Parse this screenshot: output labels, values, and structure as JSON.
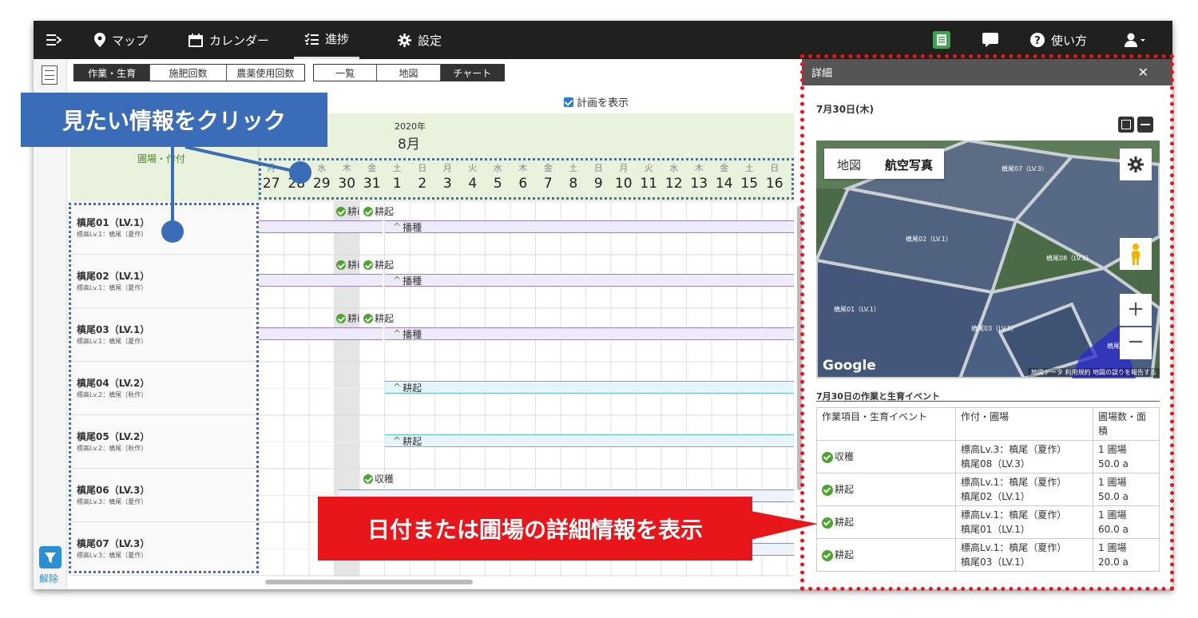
{
  "topbar": {
    "items": [
      {
        "label": "マップ",
        "icon": "map-pin-icon"
      },
      {
        "label": "カレンダー",
        "icon": "calendar-icon"
      },
      {
        "label": "進捗",
        "icon": "checklist-icon",
        "active": true
      },
      {
        "label": "設定",
        "icon": "gear-icon"
      }
    ],
    "help_label": "使い方"
  },
  "tabs_category": [
    "作業・生育",
    "施肥回数",
    "農薬使用回数"
  ],
  "tabs_view": [
    "一覧",
    "地図",
    "チャート"
  ],
  "show_plan_label": "計画を表示",
  "chart": {
    "header_left": "圃場・作付",
    "year": "2020年",
    "month": "8月",
    "days": [
      {
        "w": "月",
        "d": "27"
      },
      {
        "w": "火",
        "d": "28"
      },
      {
        "w": "水",
        "d": "29"
      },
      {
        "w": "木",
        "d": "30"
      },
      {
        "w": "金",
        "d": "31"
      },
      {
        "w": "土",
        "d": "1"
      },
      {
        "w": "日",
        "d": "2"
      },
      {
        "w": "月",
        "d": "3"
      },
      {
        "w": "火",
        "d": "4"
      },
      {
        "w": "水",
        "d": "5"
      },
      {
        "w": "木",
        "d": "6"
      },
      {
        "w": "金",
        "d": "7"
      },
      {
        "w": "土",
        "d": "8"
      },
      {
        "w": "日",
        "d": "9"
      },
      {
        "w": "月",
        "d": "10"
      },
      {
        "w": "火",
        "d": "11"
      },
      {
        "w": "水",
        "d": "12"
      },
      {
        "w": "木",
        "d": "13"
      },
      {
        "w": "金",
        "d": "14"
      },
      {
        "w": "土",
        "d": "15"
      },
      {
        "w": "日",
        "d": "16"
      }
    ],
    "rows": [
      {
        "name": "槙尾01（LV.1）",
        "sub": "標高Lv.1：槙尾（夏作）"
      },
      {
        "name": "槙尾02（LV.1）",
        "sub": "標高Lv.1：槙尾（夏作）"
      },
      {
        "name": "槙尾03（LV.1）",
        "sub": "標高Lv.1：槙尾（夏作）"
      },
      {
        "name": "槙尾04（LV.2）",
        "sub": "標高Lv.2：槙尾（秋作）"
      },
      {
        "name": "槙尾05（LV.2）",
        "sub": "標高Lv.2：槙尾（秋作）"
      },
      {
        "name": "槙尾06（LV.3）",
        "sub": "標高Lv.3：槙尾（夏作）"
      },
      {
        "name": "槙尾07（LV.3）",
        "sub": "標高Lv.3：槙尾（夏作）"
      }
    ],
    "ev_kouki_short": "耕i",
    "ev_kouki": "耕起",
    "ev_hashu": "播種",
    "ev_shukaku": "収穫"
  },
  "filter_release": "解除",
  "detail": {
    "title": "詳細",
    "date": "7月30日(木)",
    "map_tabs": [
      "地図",
      "航空写真"
    ],
    "map_labels": [
      "槙尾07（LV.3）",
      "槙尾02（LV.1）",
      "槙尾08（LV.3）",
      "槙尾01（LV.1）",
      "槙尾03（LV.1）",
      "槙尾"
    ],
    "map_footer": "地図データ  利用規約  地図の誤りを報告する",
    "map_brand": "Google",
    "section_title": "7月30日の作業と生育イベント",
    "columns": [
      "作業項目・生育イベント",
      "作付・圃場",
      "圃場数・面積"
    ],
    "rows": [
      {
        "event": "収穫",
        "crop": "標高Lv.3：槙尾（夏作）",
        "field": "槙尾08（LV.3）",
        "count": "1 圃場",
        "area": "50.0 a"
      },
      {
        "event": "耕起",
        "crop": "標高Lv.1：槙尾（夏作）",
        "field": "槙尾02（LV.1）",
        "count": "1 圃場",
        "area": "50.0 a"
      },
      {
        "event": "耕起",
        "crop": "標高Lv.1：槙尾（夏作）",
        "field": "槙尾01（LV.1）",
        "count": "1 圃場",
        "area": "60.0 a"
      },
      {
        "event": "耕起",
        "crop": "標高Lv.1：槙尾（夏作）",
        "field": "槙尾03（LV.1）",
        "count": "1 圃場",
        "area": "20.0 a"
      }
    ]
  },
  "callouts": {
    "click_info": "見たい情報をクリック",
    "show_detail": "日付または圃場の詳細情報を表示"
  }
}
